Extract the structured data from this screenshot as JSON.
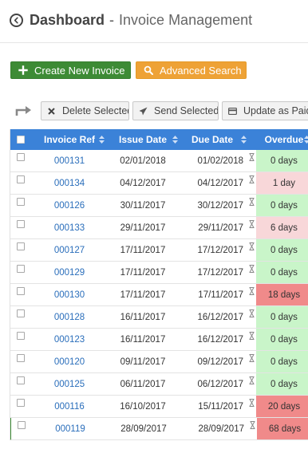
{
  "header": {
    "back_icon": "circle-arrow-left-icon",
    "title": "Dashboard",
    "separator": "-",
    "subtitle": "Invoice Management"
  },
  "actions": {
    "create_label": "Create New Invoice",
    "create_icon": "plus-icon",
    "search_label": "Advanced Search",
    "search_icon": "search-icon",
    "create_color": "#3d8b35",
    "search_color": "#eea236"
  },
  "toolbar": {
    "arrow_icon": "turn-right-arrow-icon",
    "delete_label": "Delete Selected",
    "delete_icon": "close-icon",
    "send_label": "Send Selected",
    "send_icon": "paper-plane-icon",
    "update_label": "Update as Paid",
    "update_icon": "credit-card-icon"
  },
  "table": {
    "header_color": "#3b82d8",
    "columns": {
      "ref": "Invoice Ref",
      "issue": "Issue Date",
      "due": "Due Date",
      "overdue": "Overdue"
    },
    "rows": [
      {
        "ref": "000131",
        "issue": "02/01/2018",
        "due": "01/02/2018",
        "overdue": "0 days",
        "status": "ok"
      },
      {
        "ref": "000134",
        "issue": "04/12/2017",
        "due": "04/12/2017",
        "overdue": "1 day",
        "status": "warn"
      },
      {
        "ref": "000126",
        "issue": "30/11/2017",
        "due": "30/12/2017",
        "overdue": "0 days",
        "status": "ok"
      },
      {
        "ref": "000133",
        "issue": "29/11/2017",
        "due": "29/11/2017",
        "overdue": "6 days",
        "status": "warn"
      },
      {
        "ref": "000127",
        "issue": "17/11/2017",
        "due": "17/12/2017",
        "overdue": "0 days",
        "status": "ok"
      },
      {
        "ref": "000129",
        "issue": "17/11/2017",
        "due": "17/12/2017",
        "overdue": "0 days",
        "status": "ok"
      },
      {
        "ref": "000130",
        "issue": "17/11/2017",
        "due": "17/11/2017",
        "overdue": "18 days",
        "status": "bad"
      },
      {
        "ref": "000128",
        "issue": "16/11/2017",
        "due": "16/12/2017",
        "overdue": "0 days",
        "status": "ok"
      },
      {
        "ref": "000123",
        "issue": "16/11/2017",
        "due": "16/12/2017",
        "overdue": "0 days",
        "status": "ok"
      },
      {
        "ref": "000120",
        "issue": "09/11/2017",
        "due": "09/12/2017",
        "overdue": "0 days",
        "status": "ok"
      },
      {
        "ref": "000125",
        "issue": "06/11/2017",
        "due": "06/12/2017",
        "overdue": "0 days",
        "status": "ok"
      },
      {
        "ref": "000116",
        "issue": "16/10/2017",
        "due": "15/11/2017",
        "overdue": "20 days",
        "status": "bad"
      },
      {
        "ref": "000119",
        "issue": "28/09/2017",
        "due": "28/09/2017",
        "overdue": "68 days",
        "status": "bad"
      }
    ]
  }
}
